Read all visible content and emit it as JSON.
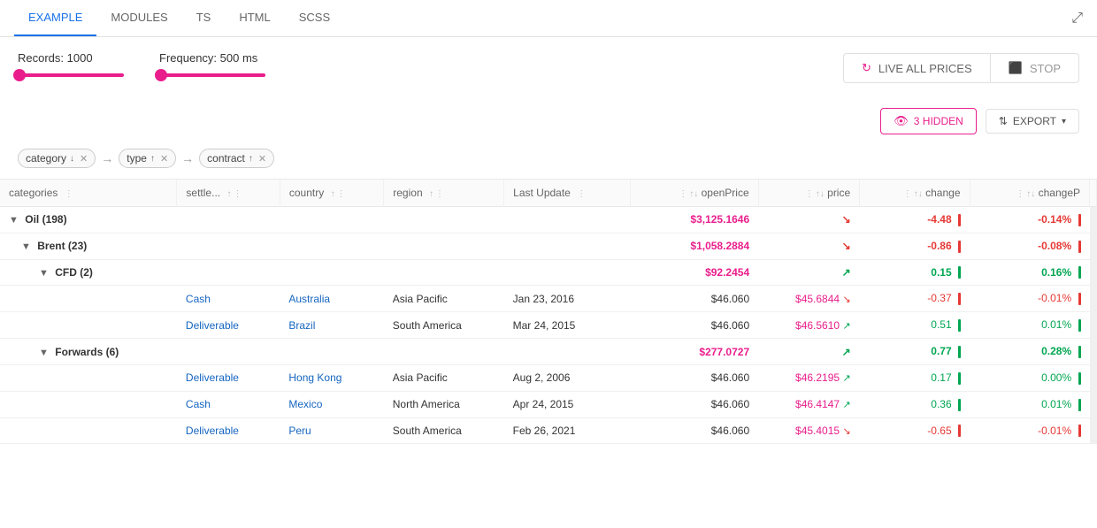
{
  "nav": {
    "tabs": [
      {
        "id": "example",
        "label": "EXAMPLE",
        "active": true
      },
      {
        "id": "modules",
        "label": "MODULES",
        "active": false
      },
      {
        "id": "ts",
        "label": "TS",
        "active": false
      },
      {
        "id": "html",
        "label": "HTML",
        "active": false
      },
      {
        "id": "scss",
        "label": "SCSS",
        "active": false
      }
    ]
  },
  "controls": {
    "records_label": "Records: 1000",
    "frequency_label": "Frequency: 500 ms"
  },
  "buttons": {
    "live_label": "LIVE ALL PRICES",
    "stop_label": "STOP",
    "hidden_label": "3 HIDDEN",
    "export_label": "EXPORT"
  },
  "filters": [
    {
      "id": "category",
      "label": "category",
      "sort": "↓"
    },
    {
      "id": "type",
      "label": "type",
      "sort": "↑"
    },
    {
      "id": "contract",
      "label": "contract",
      "sort": "↑"
    }
  ],
  "columns": [
    {
      "id": "categories",
      "label": "categories"
    },
    {
      "id": "settle",
      "label": "settle..."
    },
    {
      "id": "country",
      "label": "country"
    },
    {
      "id": "region",
      "label": "region"
    },
    {
      "id": "last_update",
      "label": "Last Update"
    },
    {
      "id": "open_price",
      "label": "openPrice"
    },
    {
      "id": "price",
      "label": "price"
    },
    {
      "id": "change",
      "label": "change"
    },
    {
      "id": "change_p",
      "label": "changeP"
    }
  ],
  "rows": [
    {
      "type": "group0",
      "label": "Oil (198)",
      "open_price": "$3,125.1646",
      "price_dir": "down",
      "change": "-4.48",
      "change_bar": "red",
      "change_p": "-0.14%",
      "change_p_bar": "red"
    },
    {
      "type": "group1",
      "label": "Brent (23)",
      "open_price": "$1,058.2884",
      "price_dir": "down",
      "change": "-0.86",
      "change_bar": "red",
      "change_p": "-0.08%",
      "change_p_bar": "red"
    },
    {
      "type": "group2",
      "label": "CFD (2)",
      "open_price": "$92.2454",
      "price_dir": "up",
      "change": "0.15",
      "change_bar": "green",
      "change_p": "0.16%",
      "change_p_bar": "green"
    },
    {
      "type": "data",
      "settle": "Cash",
      "country": "Australia",
      "region": "Asia Pacific",
      "last_update": "Jan 23, 2016",
      "open_price": "$46.060",
      "price": "$45.6844",
      "price_dir": "down",
      "change": "-0.37",
      "change_bar": "red",
      "change_p": "-0.01%",
      "change_p_bar": "red",
      "extra": "$46.0"
    },
    {
      "type": "data",
      "settle": "Deliverable",
      "country": "Brazil",
      "region": "South America",
      "last_update": "Mar 24, 2015",
      "open_price": "$46.060",
      "price": "$46.5610",
      "price_dir": "up",
      "change": "0.51",
      "change_bar": "green",
      "change_p": "0.01%",
      "change_p_bar": "green",
      "extra": "$46.0"
    },
    {
      "type": "group1",
      "label": "Forwards (6)",
      "open_price": "$277.0727",
      "price_dir": "up",
      "change": "0.77",
      "change_bar": "green",
      "change_p": "0.28%",
      "change_p_bar": "green"
    },
    {
      "type": "data",
      "settle": "Deliverable",
      "country": "Hong Kong",
      "region": "Asia Pacific",
      "last_update": "Aug 2, 2006",
      "open_price": "$46.060",
      "price": "$46.2195",
      "price_dir": "up",
      "change": "0.17",
      "change_bar": "green",
      "change_p": "0.00%",
      "change_p_bar": "green",
      "extra": "$46.0"
    },
    {
      "type": "data",
      "settle": "Cash",
      "country": "Mexico",
      "region": "North America",
      "last_update": "Apr 24, 2015",
      "open_price": "$46.060",
      "price": "$46.4147",
      "price_dir": "up",
      "change": "0.36",
      "change_bar": "green",
      "change_p": "0.01%",
      "change_p_bar": "green",
      "extra": "$46.0"
    },
    {
      "type": "data",
      "settle": "Deliverable",
      "country": "Peru",
      "region": "South America",
      "last_update": "Feb 26, 2021",
      "open_price": "$46.060",
      "price": "$45.4015",
      "price_dir": "down",
      "change": "-0.65",
      "change_bar": "red",
      "change_p": "-0.01%",
      "change_p_bar": "red",
      "extra": "$46.0"
    }
  ]
}
